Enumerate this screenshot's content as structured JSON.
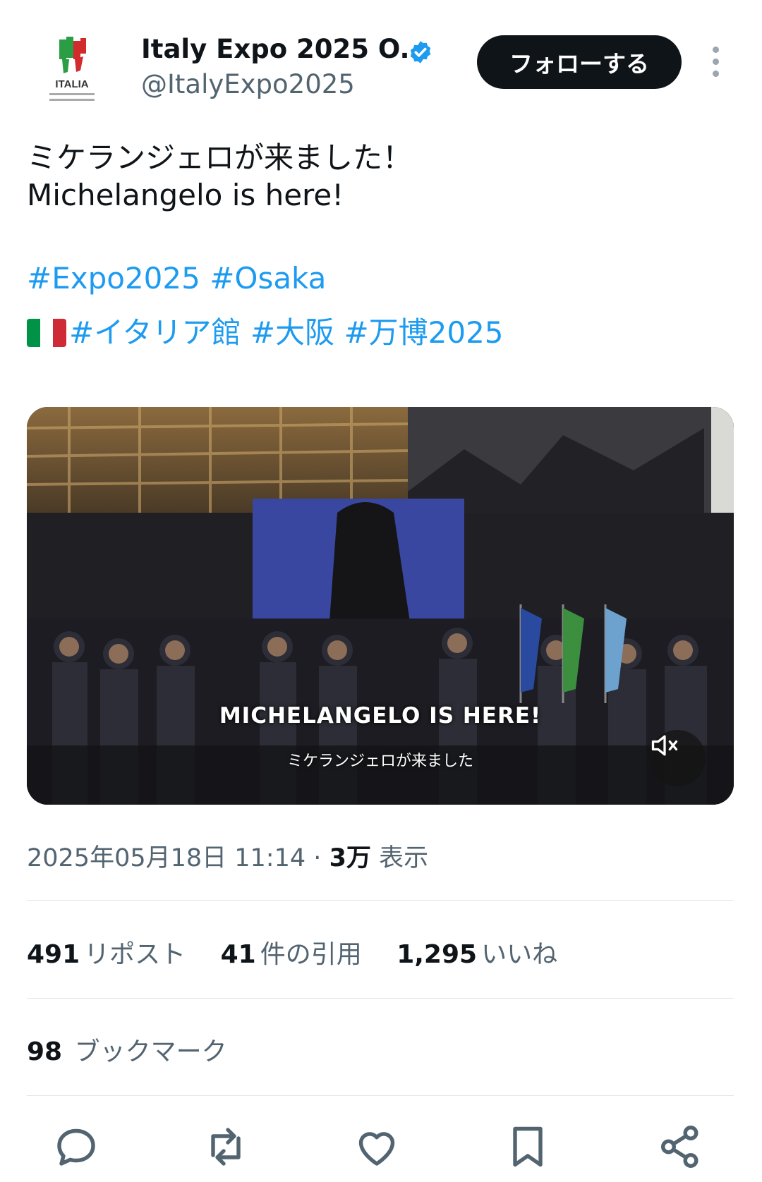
{
  "account": {
    "display_name": "Italy Expo 2025 O...",
    "handle": "@ItalyExpo2025",
    "avatar_text": "ITALIA",
    "verified": true
  },
  "follow_label": "フォローする",
  "tweet": {
    "line1": "ミケランジェロが来ました！",
    "line2": "Michelangelo is here!",
    "hashtags_line1": [
      "#Expo2025",
      "#Osaka"
    ],
    "hashtags_line2": [
      "#イタリア館",
      "#大阪",
      "#万博2025"
    ],
    "flag": "italy-flag-icon"
  },
  "video": {
    "caption_en": "MICHELANGELO IS HERE!",
    "caption_ja": "ミケランジェロが来ました"
  },
  "meta": {
    "datetime": "2025年05月18日 11:14",
    "separator": "·",
    "views": "3万",
    "views_label": "表示"
  },
  "stats": {
    "reposts": "491",
    "reposts_label": "リポスト",
    "quotes": "41",
    "quotes_label": "件の引用",
    "likes": "1,295",
    "likes_label": "いいね"
  },
  "bookmarks": {
    "count": "98",
    "label": "ブックマーク"
  },
  "colors": {
    "accent": "#1d9bf0",
    "text": "#0f1419",
    "secondary": "#536471",
    "button": "#0f1419"
  }
}
